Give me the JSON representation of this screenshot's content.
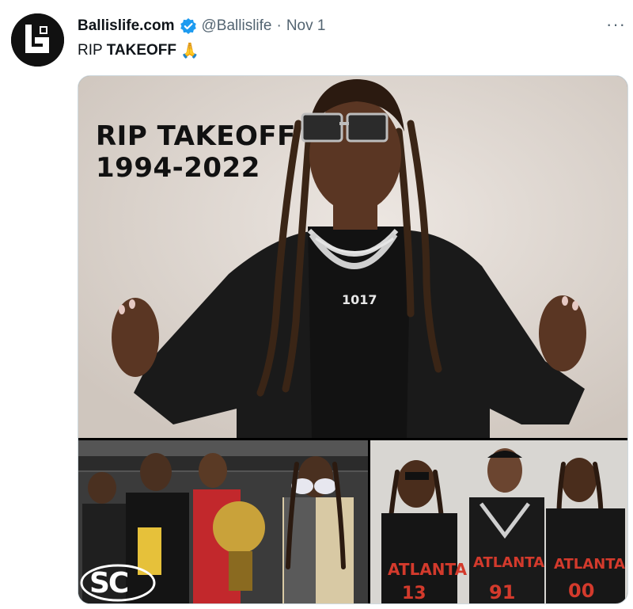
{
  "author": {
    "display_name": "Ballislife.com",
    "handle": "@Ballislife",
    "separator": "·",
    "date": "Nov 1",
    "verified_color": "#1d9bf0",
    "avatar_icon": "ballislife-logo-icon"
  },
  "tweet": {
    "text_prefix": "RIP",
    "text_bold": "TAKEOFF",
    "emoji": "🙏"
  },
  "more_icon": "ellipsis-icon",
  "more_label": "···",
  "media": {
    "main": {
      "headline_line1": "RIP TAKEOFF",
      "headline_line2": "1994-2022",
      "chain_text": "1017"
    },
    "bottom_left": {
      "logo_text": "SC"
    },
    "bottom_right": {
      "jersey_text": "ATLANTA",
      "jersey_numbers": [
        "13",
        "91",
        "00"
      ]
    }
  }
}
